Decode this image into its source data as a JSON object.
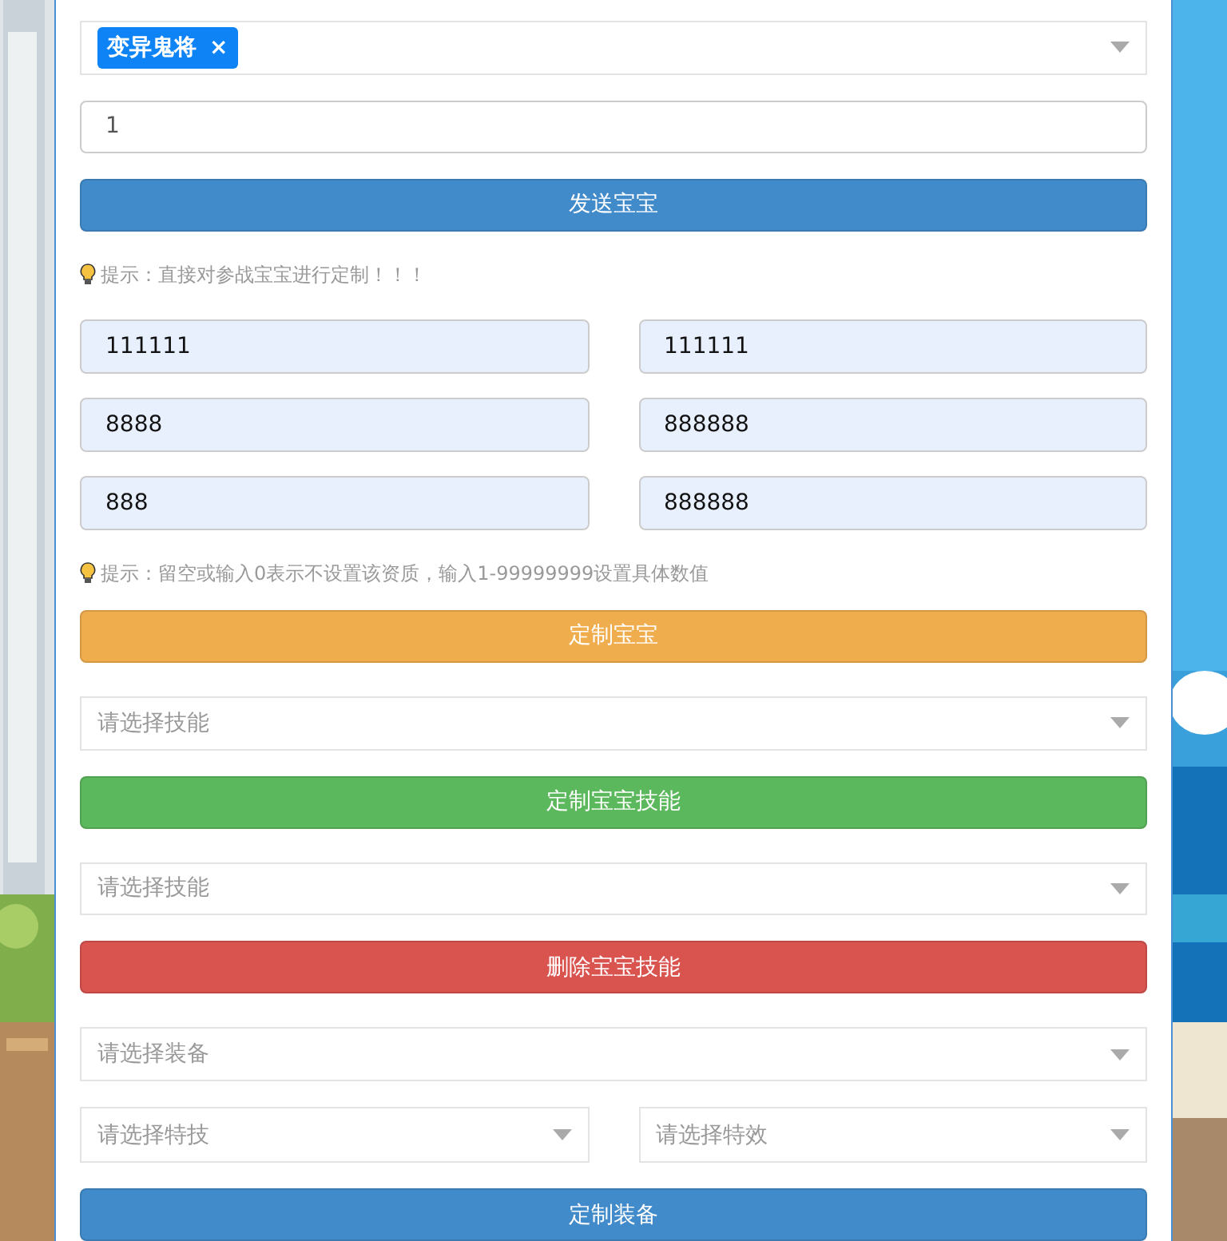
{
  "form": [
    {
      "kind": "tag_select",
      "tags": [
        {
          "label": "变异鬼将",
          "remove": "×"
        }
      ]
    },
    {
      "kind": "input",
      "value": "1"
    },
    {
      "kind": "button",
      "color": "#428bca",
      "label": "发送宝宝"
    },
    {
      "kind": "hint",
      "text": "提示：直接对参战宝宝进行定制！！！"
    },
    {
      "kind": "input_grid",
      "fields": [
        {
          "value": "111111"
        },
        {
          "value": "111111"
        },
        {
          "value": "8888"
        },
        {
          "value": "888888"
        },
        {
          "value": "888"
        },
        {
          "value": "888888"
        }
      ]
    },
    {
      "kind": "hint",
      "text": "提示：留空或输入0表示不设置该资质，输入1-99999999设置具体数值"
    },
    {
      "kind": "button",
      "color": "#f0ad4e",
      "label": "定制宝宝"
    },
    {
      "kind": "select",
      "placeholder": "请选择技能"
    },
    {
      "kind": "button",
      "color": "#5cb85c",
      "label": "定制宝宝技能"
    },
    {
      "kind": "select",
      "placeholder": "请选择技能"
    },
    {
      "kind": "button",
      "color": "#d9534f",
      "label": "删除宝宝技能"
    },
    {
      "kind": "select",
      "placeholder": "请选择装备"
    },
    {
      "kind": "select_pair",
      "selects": [
        {
          "placeholder": "请选择特技"
        },
        {
          "placeholder": "请选择特效"
        }
      ]
    },
    {
      "kind": "button",
      "color": "#428bca",
      "label": "定制装备"
    }
  ]
}
